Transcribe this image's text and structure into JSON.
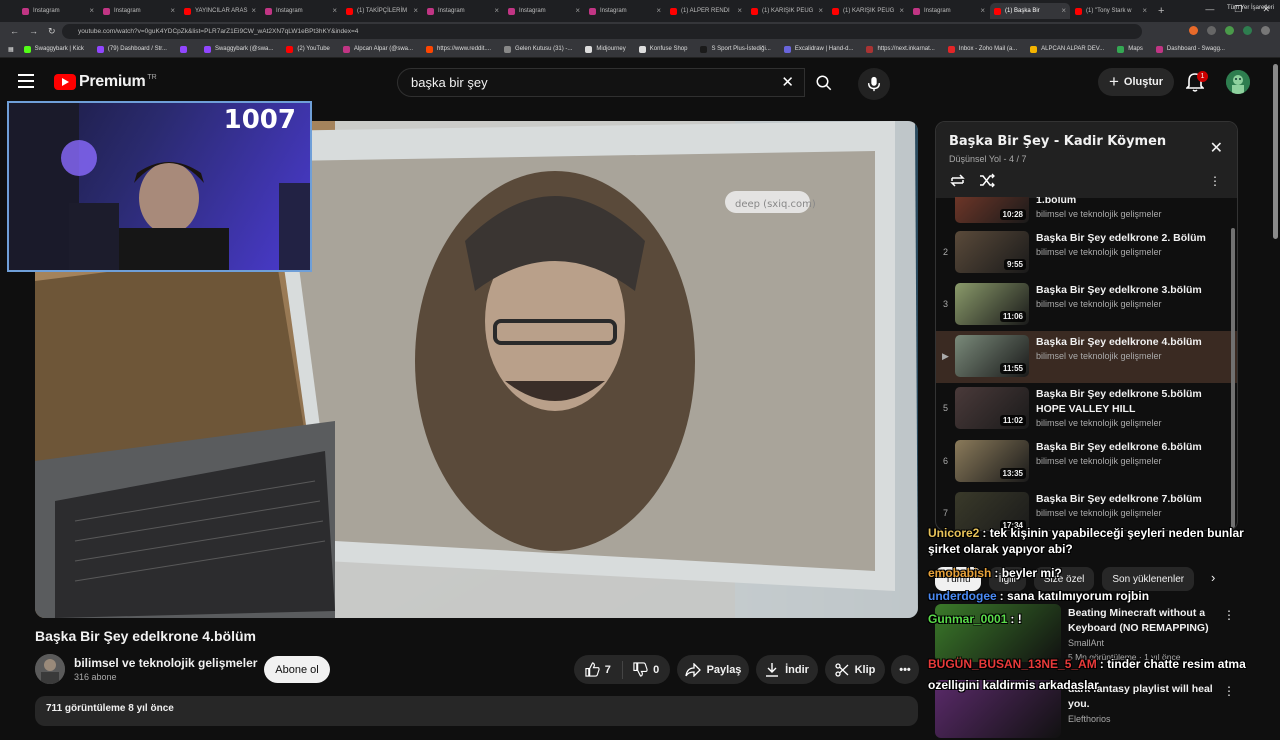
{
  "browser": {
    "tabs": [
      {
        "label": "Instagram",
        "color": "#c13584"
      },
      {
        "label": "Instagram",
        "color": "#c13584"
      },
      {
        "label": "YAYINCILAR ARAS",
        "color": "#ff0000"
      },
      {
        "label": "Instagram",
        "color": "#c13584"
      },
      {
        "label": "(1) TAKİPÇİLERİM",
        "color": "#ff0000"
      },
      {
        "label": "Instagram",
        "color": "#c13584"
      },
      {
        "label": "Instagram",
        "color": "#c13584"
      },
      {
        "label": "Instagram",
        "color": "#c13584"
      },
      {
        "label": "(1) ALPER RENDI",
        "color": "#ff0000"
      },
      {
        "label": "(1) KARIŞIK PEUG",
        "color": "#ff0000"
      },
      {
        "label": "(1) KARIŞIK PEUG",
        "color": "#ff0000"
      },
      {
        "label": "Instagram",
        "color": "#c13584"
      },
      {
        "label": "(1) Başka Bir",
        "color": "#ff0000"
      },
      {
        "label": "(1) \"Tony Stark w",
        "color": "#ff0000"
      }
    ],
    "url": "youtube.com/watch?v=0guK4YDCpZk&list=PLR7arZ1Ei9CW_wAt2XN7qLW1eBPt3hKY&index=4",
    "bookmarks": [
      {
        "label": "Swaggybark | Kick",
        "color": "#53fc18"
      },
      {
        "label": "(79) Dashboard / Str...",
        "color": "#9146ff"
      },
      {
        "label": "",
        "color": "#9146ff"
      },
      {
        "label": "Swaggybark (@swa...",
        "color": "#9146ff"
      },
      {
        "label": "(2) YouTube",
        "color": "#ff0000"
      },
      {
        "label": "Alpcan Alpar (@swa...",
        "color": "#c13584"
      },
      {
        "label": "https://www.reddit....",
        "color": "#ff4500"
      },
      {
        "label": "Gelen Kutusu (31) -...",
        "color": "#888888"
      },
      {
        "label": "Midjourney",
        "color": "#dddddd"
      },
      {
        "label": "Konfuse Shop",
        "color": "#dddddd"
      },
      {
        "label": "S Sport Plus-İstediği...",
        "color": "#1a1a1a"
      },
      {
        "label": "Excalidraw | Hand-d...",
        "color": "#6965db"
      },
      {
        "label": "https://next.inkarnat...",
        "color": "#aa3333"
      },
      {
        "label": "Inbox - Zoho Mail (a...",
        "color": "#e42527"
      },
      {
        "label": "ALPCAN ALPAR DEV...",
        "color": "#f4b400"
      },
      {
        "label": "Maps",
        "color": "#34a853"
      },
      {
        "label": "Dashboard - Swagg...",
        "color": "#c13584"
      }
    ],
    "bookmarks_right": "Tüm Yer İşaretleri"
  },
  "header": {
    "logo_text": "Premium",
    "country": "TR",
    "search_value": "başka bir şey",
    "create_label": "Oluştur",
    "notif_count": "1"
  },
  "webcam": {
    "counter": "1007"
  },
  "video": {
    "title": "Başka Bir Şey edelkrone 4.bölüm",
    "channel": "bilimsel ve teknolojik gelişmeler",
    "subs": "316 abone",
    "subscribe_label": "Abone ol",
    "likes": "7",
    "dislikes": "0",
    "share_label": "Paylaş",
    "download_label": "İndir",
    "clip_label": "Klip",
    "desc": "711 görüntüleme  8 yıl önce"
  },
  "playlist": {
    "title": "Başka Bir Şey - Kadir Köymen",
    "subtitle": "Düşünsel Yol - 4 / 7",
    "items": [
      {
        "idx": "",
        "title": "1.bölüm",
        "channel": "bilimsel ve teknolojik gelişmeler",
        "duration": "10:28",
        "thumb": "#7a3a2a"
      },
      {
        "idx": "2",
        "title": "Başka Bir Şey edelkrone 2. Bölüm",
        "channel": "bilimsel ve teknolojik gelişmeler",
        "duration": "9:55",
        "thumb": "#5a4a3a"
      },
      {
        "idx": "3",
        "title": "Başka Bir Şey edelkrone 3.bölüm",
        "channel": "bilimsel ve teknolojik gelişmeler",
        "duration": "11:06",
        "thumb": "#8a9a6a"
      },
      {
        "idx": "▶",
        "title": "Başka Bir Şey edelkrone 4.bölüm",
        "channel": "bilimsel ve teknolojik gelişmeler",
        "duration": "11:55",
        "thumb": "#7a8a7a"
      },
      {
        "idx": "5",
        "title": "Başka Bir Şey edelkrone 5.bölüm HOPE VALLEY HILL",
        "channel": "bilimsel ve teknolojik gelişmeler",
        "duration": "11:02",
        "thumb": "#4a3a3a"
      },
      {
        "idx": "6",
        "title": "Başka Bir Şey edelkrone 6.bölüm",
        "channel": "bilimsel ve teknolojik gelişmeler",
        "duration": "13:35",
        "thumb": "#8a7a5a"
      },
      {
        "idx": "7",
        "title": "Başka Bir Şey edelkrone 7.bölüm",
        "channel": "bilimsel ve teknolojik gelişmeler",
        "duration": "17:34",
        "thumb": "#3a3a2a"
      }
    ]
  },
  "chips": [
    {
      "label": "Tümü",
      "active": true
    },
    {
      "label": "İlgili",
      "active": false
    },
    {
      "label": "Size özel",
      "active": false
    },
    {
      "label": "Son yüklenenler",
      "active": false
    }
  ],
  "recommendations": [
    {
      "title": "Beating Minecraft without a Keyboard (NO REMAPPING)",
      "channel": "SmallAnt",
      "meta": "5 Mn görüntüleme · 1 yıl önce",
      "thumb": "#3b7a2a"
    },
    {
      "title": "dark fantasy playlist will heal you.",
      "channel": "Elefthorios",
      "meta": "",
      "thumb": "#5a2a6a"
    }
  ],
  "chat": [
    {
      "user": "Unicore2",
      "color": "#e8c35a",
      "msg": "tek kişinin yapabileceği şeyleri neden bunlar"
    },
    {
      "user": "",
      "color": "#ffffff",
      "msg": "şirket olarak yapıyor abi?"
    },
    {
      "user": "emobabish",
      "color": "#e8a23a",
      "msg": "beyler mi?"
    },
    {
      "user": "underdogee",
      "color": "#4a8af4",
      "msg": "sana katılmıyorum rojbin"
    },
    {
      "user": "Gunmar_0001",
      "color": "#5adc4a",
      "msg": "!"
    },
    {
      "user": "BUGÜN_BUSAN_13NE_5_AM",
      "color": "#e83a3a",
      "msg": "tinder chatte resim atma"
    },
    {
      "user": "",
      "color": "#ffffff",
      "msg": "ozelligini kaldirmis arkadaslar"
    }
  ]
}
